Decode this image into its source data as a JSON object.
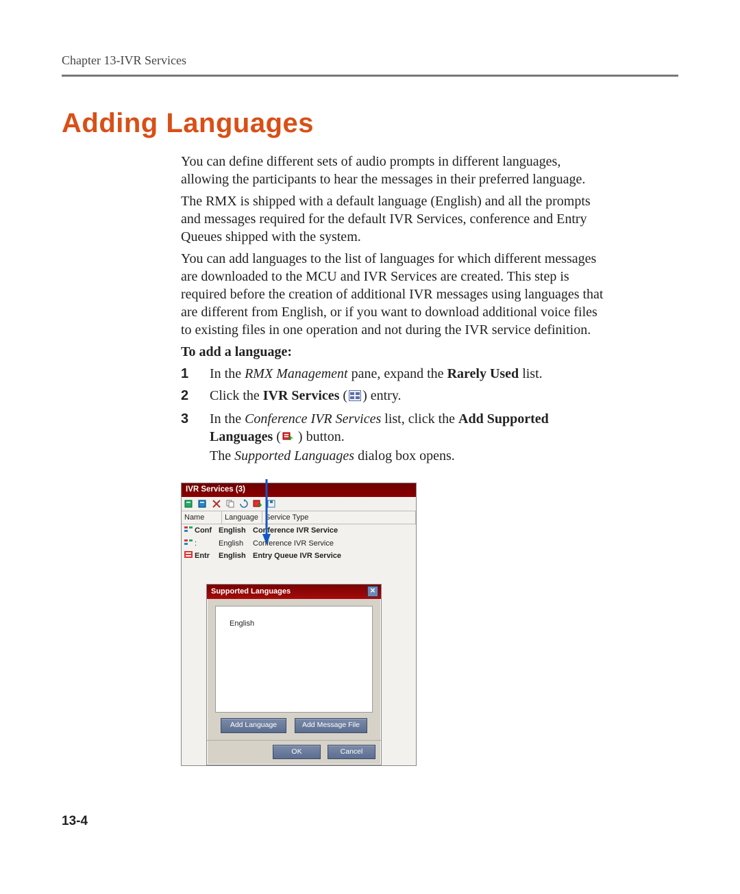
{
  "header": {
    "running": "Chapter 13-IVR Services"
  },
  "title": "Adding Languages",
  "para1": "You can define different sets of audio prompts in different languages, allowing the participants to hear the messages in their preferred language.",
  "para2": "The RMX is shipped with a default language (English) and all the prompts and messages required for the default IVR Services, conference and Entry Queues shipped with the system.",
  "para3": "You can add languages to the list of languages for which different messages are downloaded to the MCU and IVR Services are created. This step is required before the creation of additional IVR messages using languages that are different from English, or if you want to download additional voice files to existing files in one operation and not during the IVR service definition.",
  "subhead": "To add a language:",
  "steps": [
    {
      "num": "1",
      "pre": "In the ",
      "it1": "RMX Management",
      "mid": " pane, expand the ",
      "b1": "Rarely Used",
      "post": " list."
    },
    {
      "num": "2",
      "pre": "Click the ",
      "b1": "IVR Services",
      "post_open": " (",
      "icon": "ivr-services-icon",
      "post_close": ") entry."
    },
    {
      "num": "3",
      "pre": "In the ",
      "it1": "Conference IVR Services",
      "mid": " list, click the ",
      "b1": "Add Supported Languages",
      "post_open": " (",
      "icon": "add-languages-icon",
      "post_close": " ) button."
    }
  ],
  "step3_tail_pre": "The ",
  "step3_tail_it": "Supported Languages",
  "step3_tail_post": " dialog box opens.",
  "ivr_panel": {
    "title": "IVR Services (3)",
    "columns": {
      "name": "Name",
      "lang": "Language",
      "type": "Service Type"
    },
    "toolbar_icons": [
      "new-conf-ivr-icon",
      "new-eq-ivr-icon",
      "delete-icon",
      "copy-icon",
      "refresh-icon",
      "add-languages-icon",
      "replace-files-icon"
    ],
    "rows": [
      {
        "name": "Conf",
        "lang": "English",
        "type": "Conference IVR Service",
        "bold": true,
        "icon": "conf-row-icon"
      },
      {
        "name": ":",
        "lang": "English",
        "type": "Conference IVR Service",
        "bold": false,
        "icon": "conf-row-icon"
      },
      {
        "name": "Entr",
        "lang": "English",
        "type": "Entry Queue IVR Service",
        "bold": true,
        "icon": "entry-row-icon"
      }
    ]
  },
  "dialog": {
    "title": "Supported Languages",
    "items": [
      "English"
    ],
    "buttons": {
      "add_lang": "Add Language",
      "add_msg": "Add Message File",
      "ok": "OK",
      "cancel": "Cancel"
    }
  },
  "page_number": "13-4"
}
